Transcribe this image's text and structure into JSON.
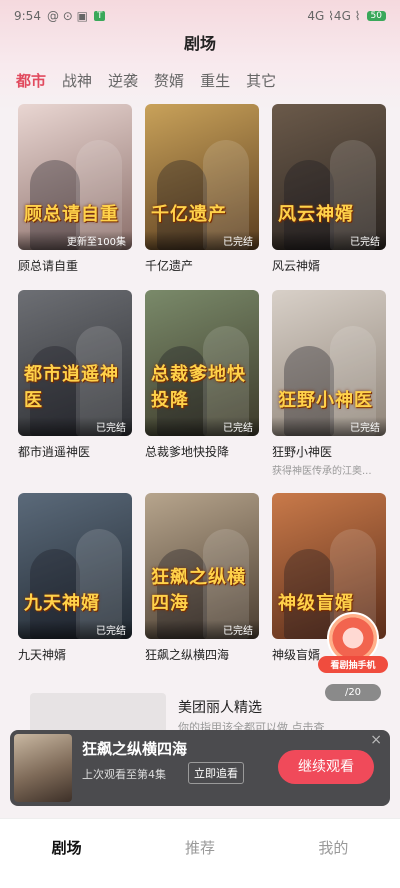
{
  "status_bar": {
    "time": "9:54",
    "left_icons": "@ ⊙ ▣",
    "app_badge": "T",
    "network": "4G ⌇4G ⌇",
    "battery": "50"
  },
  "header": {
    "title": "剧场"
  },
  "tabs": [
    {
      "label": "都市",
      "active": true
    },
    {
      "label": "战神",
      "active": false
    },
    {
      "label": "逆袭",
      "active": false
    },
    {
      "label": "赘婿",
      "active": false
    },
    {
      "label": "重生",
      "active": false
    },
    {
      "label": "其它",
      "active": false
    }
  ],
  "dramas": [
    {
      "title": "顾总请自重",
      "poster_text": "顾总请自重",
      "status": "更新至100集",
      "subtitle": "",
      "color1": "#e9d6d2",
      "color2": "#8b6f6a"
    },
    {
      "title": "千亿遗产",
      "poster_text": "千亿遗产",
      "status": "已完结",
      "subtitle": "",
      "color1": "#c9a25a",
      "color2": "#5a3d1f"
    },
    {
      "title": "风云神婿",
      "poster_text": "风云神婿",
      "status": "已完结",
      "subtitle": "",
      "color1": "#6b5a4a",
      "color2": "#2a2420"
    },
    {
      "title": "都市逍遥神医",
      "poster_text": "都市逍遥神医",
      "status": "已完结",
      "subtitle": "",
      "color1": "#6d6f74",
      "color2": "#2d2f33"
    },
    {
      "title": "总裁爹地快投降",
      "poster_text": "总裁爹地快投降",
      "status": "已完结",
      "subtitle": "",
      "color1": "#7a8a6a",
      "color2": "#3d3a2a"
    },
    {
      "title": "狂野小神医",
      "poster_text": "狂野小神医",
      "status": "已完结",
      "subtitle": "获得神医传承的江奥...",
      "color1": "#d8d0c8",
      "color2": "#8f8478"
    },
    {
      "title": "九天神婿",
      "poster_text": "九天神婿",
      "status": "已完结",
      "subtitle": "",
      "color1": "#5b6a7a",
      "color2": "#222a33"
    },
    {
      "title": "狂飙之纵横四海",
      "poster_text": "狂飙之纵横四海",
      "status": "已完结",
      "subtitle": "",
      "color1": "#b7a58d",
      "color2": "#4a3d30"
    },
    {
      "title": "神级盲婿",
      "poster_text": "神级盲婿",
      "status": "",
      "subtitle": "",
      "color1": "#c97a4a",
      "color2": "#5a2d1a"
    }
  ],
  "lottery": {
    "label": "看剧抽手机"
  },
  "page_counter": "/20",
  "ad": {
    "title": "美团丽人精选",
    "desc": "你的指甲该全都可以做 点击查"
  },
  "resume": {
    "title": "狂飙之纵横四海",
    "progress": "上次观看至第4集",
    "follow_label": "立即追看",
    "continue_label": "继续观看",
    "close_icon": "×"
  },
  "bottom_nav": [
    {
      "label": "剧场",
      "active": true
    },
    {
      "label": "推荐",
      "active": false
    },
    {
      "label": "我的",
      "active": false
    }
  ]
}
